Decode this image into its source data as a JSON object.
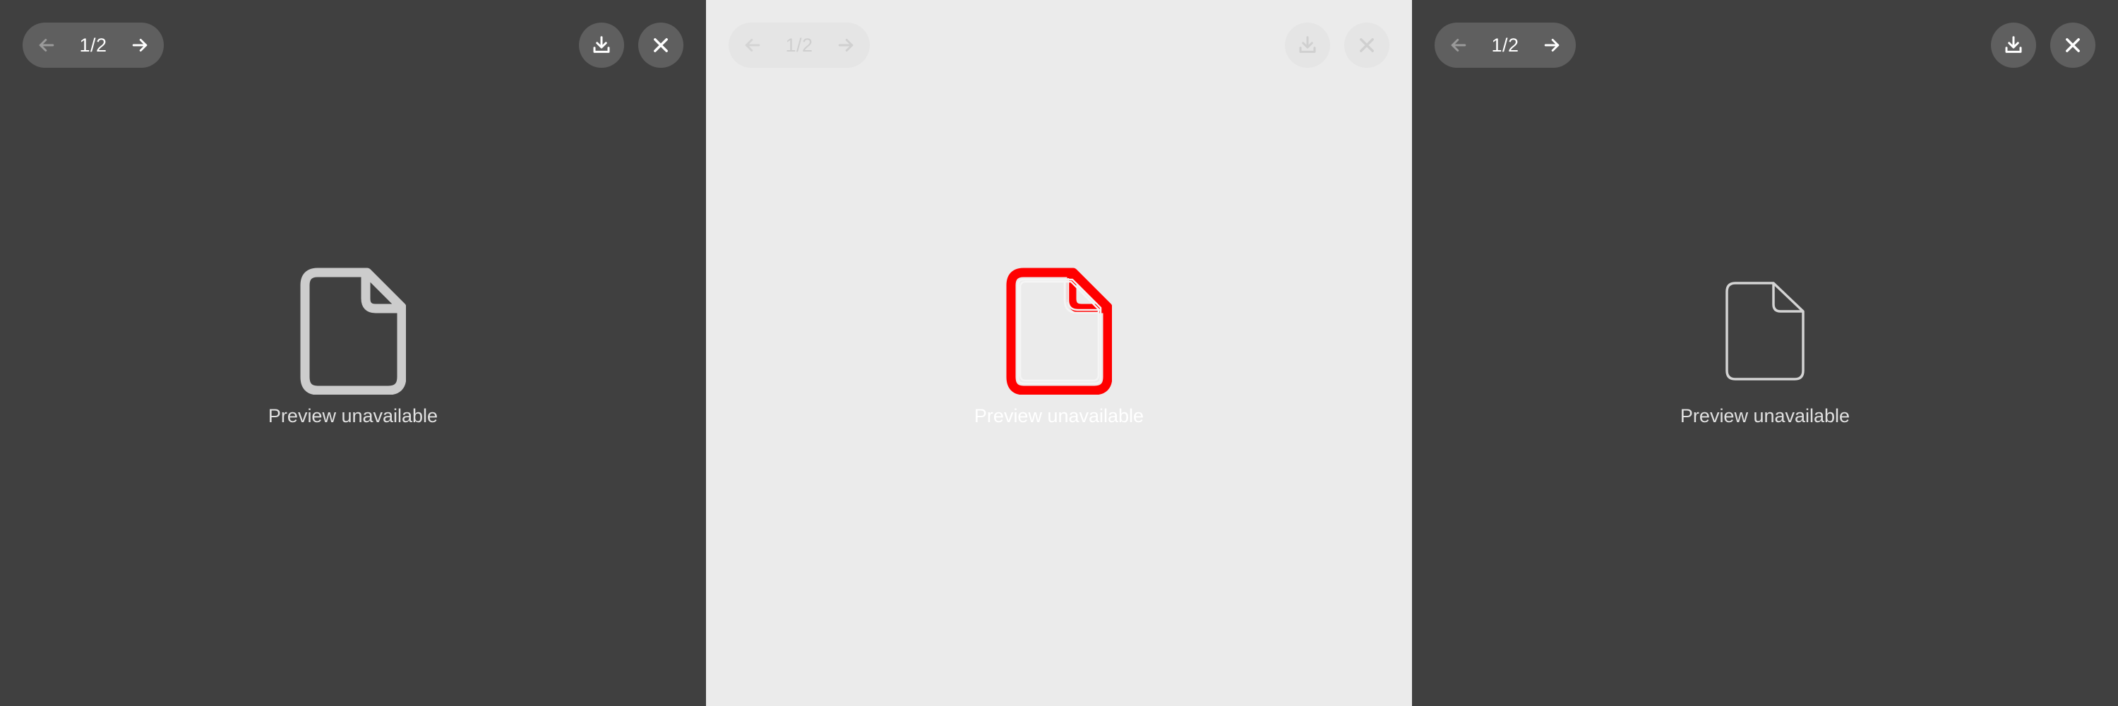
{
  "viewer": {
    "page_counter": "1/2",
    "preview_message": "Preview unavailable"
  },
  "icons": {
    "previous": "arrow-left-icon",
    "next": "arrow-right-icon",
    "download": "download-icon",
    "close": "close-icon",
    "file": "file-icon"
  },
  "colors": {
    "dark_background": "#404040",
    "light_background": "#ebebeb",
    "highlight": "#ff0000"
  }
}
